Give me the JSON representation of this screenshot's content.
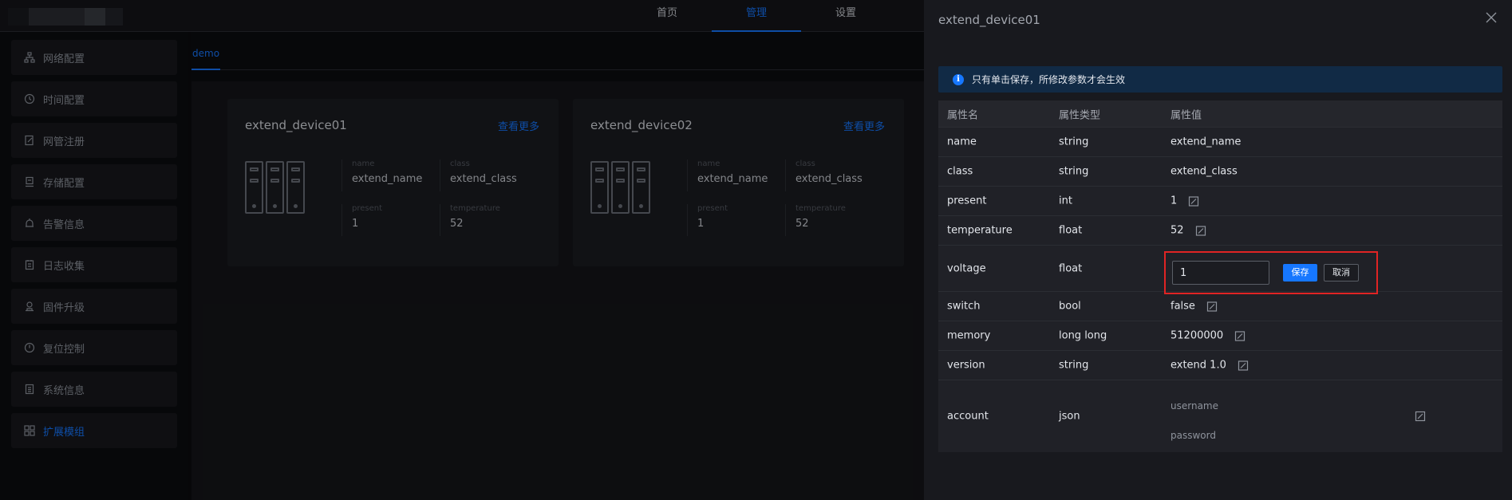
{
  "nav": {
    "items": [
      "首页",
      "管理",
      "设置"
    ],
    "active_index": 1
  },
  "sidebar": {
    "items": [
      {
        "label": "网络配置",
        "icon": "network-icon"
      },
      {
        "label": "时间配置",
        "icon": "clock-icon"
      },
      {
        "label": "网管注册",
        "icon": "register-icon"
      },
      {
        "label": "存储配置",
        "icon": "storage-icon"
      },
      {
        "label": "告警信息",
        "icon": "alarm-icon"
      },
      {
        "label": "日志收集",
        "icon": "log-icon"
      },
      {
        "label": "固件升级",
        "icon": "upgrade-icon"
      },
      {
        "label": "复位控制",
        "icon": "reset-icon"
      },
      {
        "label": "系统信息",
        "icon": "info-list-icon"
      },
      {
        "label": "扩展模组",
        "icon": "grid-icon"
      }
    ],
    "active_index": 9
  },
  "tabs": {
    "active": "demo"
  },
  "cards": [
    {
      "title": "extend_device01",
      "more": "查看更多",
      "props": {
        "name_key": "name",
        "name_val": "extend_name",
        "class_key": "class",
        "class_val": "extend_class",
        "present_key": "present",
        "present_val": "1",
        "temp_key": "temperature",
        "temp_val": "52"
      }
    },
    {
      "title": "extend_device02",
      "more": "查看更多",
      "props": {
        "name_key": "name",
        "name_val": "extend_name",
        "class_key": "class",
        "class_val": "extend_class",
        "present_key": "present",
        "present_val": "1",
        "temp_key": "temperature",
        "temp_val": "52"
      }
    }
  ],
  "drawer": {
    "title": "extend_device01",
    "notice": "只有单击保存，所修改参数才会生效",
    "headers": {
      "name": "属性名",
      "type": "属性类型",
      "value": "属性值"
    },
    "rows": [
      {
        "name": "name",
        "type": "string",
        "value": "extend_name",
        "editable": false
      },
      {
        "name": "class",
        "type": "string",
        "value": "extend_class",
        "editable": false
      },
      {
        "name": "present",
        "type": "int",
        "value": "1",
        "editable": true
      },
      {
        "name": "temperature",
        "type": "float",
        "value": "52",
        "editable": true
      },
      {
        "name": "voltage",
        "type": "float",
        "value": "1",
        "editing": true
      },
      {
        "name": "switch",
        "type": "bool",
        "value": "false",
        "editable": true
      },
      {
        "name": "memory",
        "type": "long long",
        "value": "51200000",
        "editable": true
      },
      {
        "name": "version",
        "type": "string",
        "value": "extend 1.0",
        "editable": true
      }
    ],
    "account": {
      "name": "account",
      "type": "json",
      "username_placeholder": "username",
      "password_placeholder": "password"
    },
    "edit": {
      "save_label": "保存",
      "cancel_label": "取消"
    }
  }
}
